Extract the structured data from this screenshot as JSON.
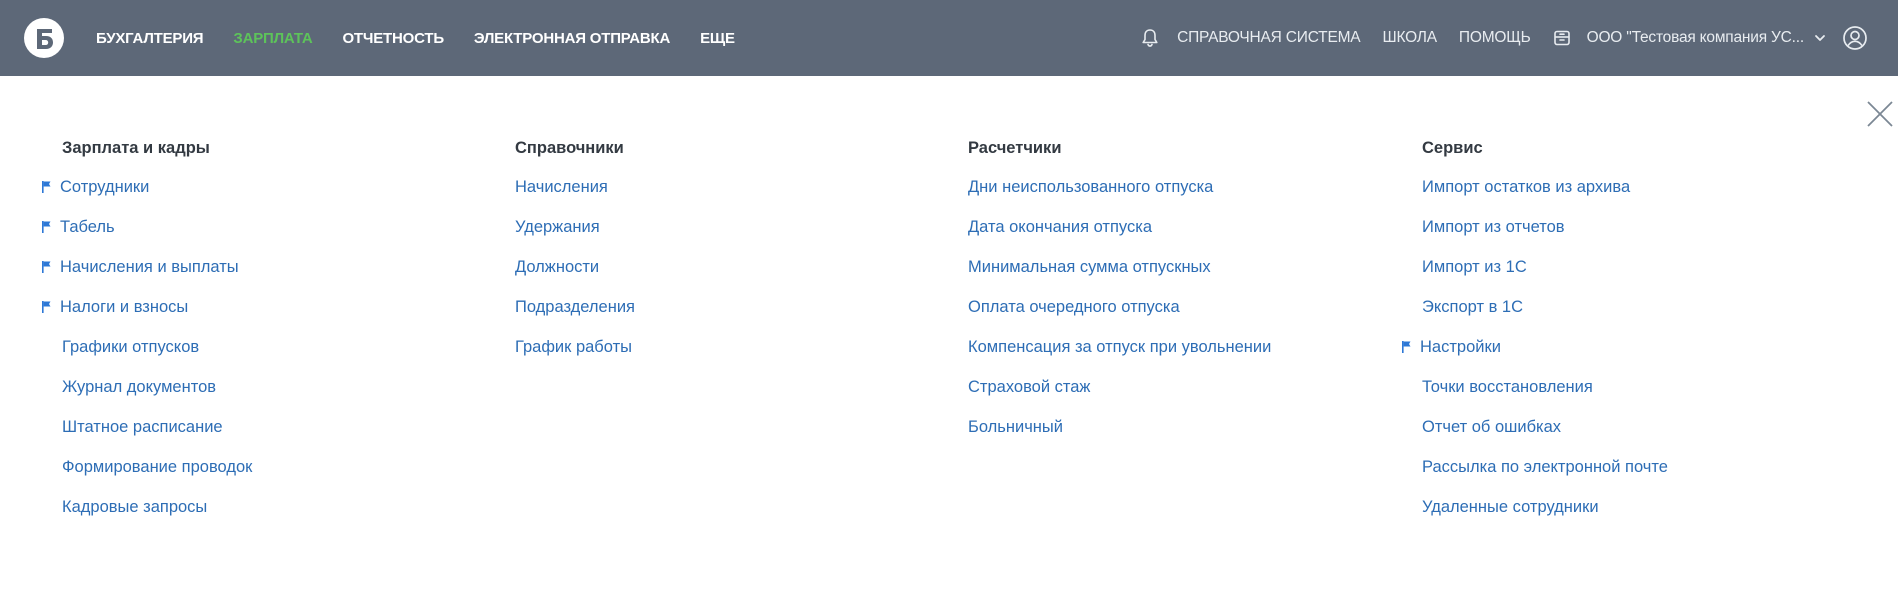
{
  "colors": {
    "topbar": "#5d6878",
    "active_nav": "#5dc35a",
    "link": "#2d6db5",
    "heading": "#333a42",
    "flag": "#2d78d6"
  },
  "topbar": {
    "logo_icon": "b-logo-icon",
    "nav_left": [
      {
        "label": "БУХГАЛТЕРИЯ",
        "active": false
      },
      {
        "label": "ЗАРПЛАТА",
        "active": true
      },
      {
        "label": "ОТЧЕТНОСТЬ",
        "active": false
      },
      {
        "label": "ЭЛЕКТРОННАЯ ОТПРАВКА",
        "active": false
      },
      {
        "label": "ЕЩЕ",
        "active": false
      }
    ],
    "reference_label": "СПРАВОЧНАЯ СИСТЕМА",
    "school_label": "ШКОЛА",
    "help_label": "ПОМОЩЬ",
    "company_label": "ООО \"Тестовая компания УС..."
  },
  "menu": {
    "columns": [
      {
        "title": "Зарплата и кадры",
        "items": [
          {
            "label": "Сотрудники",
            "flagged": true
          },
          {
            "label": "Табель",
            "flagged": true
          },
          {
            "label": "Начисления и выплаты",
            "flagged": true
          },
          {
            "label": "Налоги и взносы",
            "flagged": true
          },
          {
            "label": "Графики отпусков",
            "flagged": false
          },
          {
            "label": "Журнал документов",
            "flagged": false
          },
          {
            "label": "Штатное расписание",
            "flagged": false
          },
          {
            "label": "Формирование проводок",
            "flagged": false
          },
          {
            "label": "Кадровые запросы",
            "flagged": false
          }
        ]
      },
      {
        "title": "Справочники",
        "items": [
          {
            "label": "Начисления",
            "flagged": false
          },
          {
            "label": "Удержания",
            "flagged": false
          },
          {
            "label": "Должности",
            "flagged": false
          },
          {
            "label": "Подразделения",
            "flagged": false
          },
          {
            "label": "График работы",
            "flagged": false
          }
        ]
      },
      {
        "title": "Расчетчики",
        "items": [
          {
            "label": "Дни неиспользованного отпуска",
            "flagged": false
          },
          {
            "label": "Дата окончания отпуска",
            "flagged": false
          },
          {
            "label": "Минимальная сумма отпускных",
            "flagged": false
          },
          {
            "label": "Оплата очередного отпуска",
            "flagged": false
          },
          {
            "label": "Компенсация за отпуск при увольнении",
            "flagged": false
          },
          {
            "label": "Страховой стаж",
            "flagged": false
          },
          {
            "label": "Больничный",
            "flagged": false
          }
        ]
      },
      {
        "title": "Сервис",
        "items": [
          {
            "label": "Импорт остатков из архива",
            "flagged": false
          },
          {
            "label": "Импорт из отчетов",
            "flagged": false
          },
          {
            "label": "Импорт из 1С",
            "flagged": false
          },
          {
            "label": "Экспорт в 1С",
            "flagged": false
          },
          {
            "label": "Настройки",
            "flagged": true
          },
          {
            "label": "Точки восстановления",
            "flagged": false
          },
          {
            "label": "Отчет об ошибках",
            "flagged": false
          },
          {
            "label": "Рассылка по электронной почте",
            "flagged": false
          },
          {
            "label": "Удаленные сотрудники",
            "flagged": false
          }
        ]
      }
    ]
  }
}
